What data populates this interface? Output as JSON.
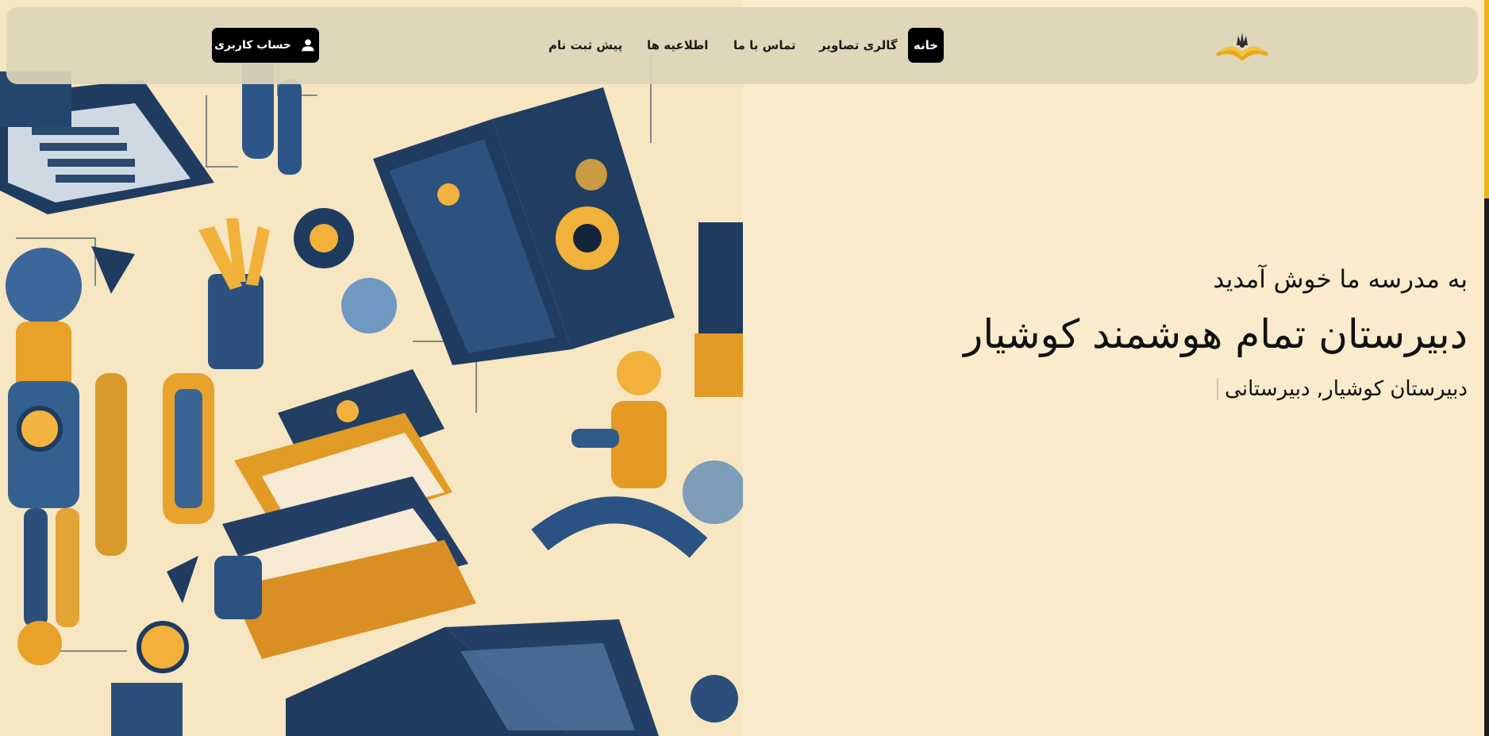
{
  "navbar": {
    "logo_icon": "school-logo-icon",
    "home_label": "خانه",
    "links": [
      "گالری تصاویر",
      "تماس با ما",
      "اطلاعیه ها",
      "پیش ثبت نام"
    ],
    "account": {
      "label": "حساب کاربری",
      "icon": "user-icon"
    }
  },
  "hero": {
    "welcome": "به مدرسه ما خوش آمدید",
    "title": "دبیرستان تمام هوشمند کوشیار",
    "typed_text": "دبیرستان کوشیار, دبیرستانی"
  },
  "colors": {
    "background": "#f9ebcb",
    "navbar": "#ded4b8",
    "accent": "#f2b31a",
    "navy": "#1f3b5f",
    "button": "#000000"
  }
}
